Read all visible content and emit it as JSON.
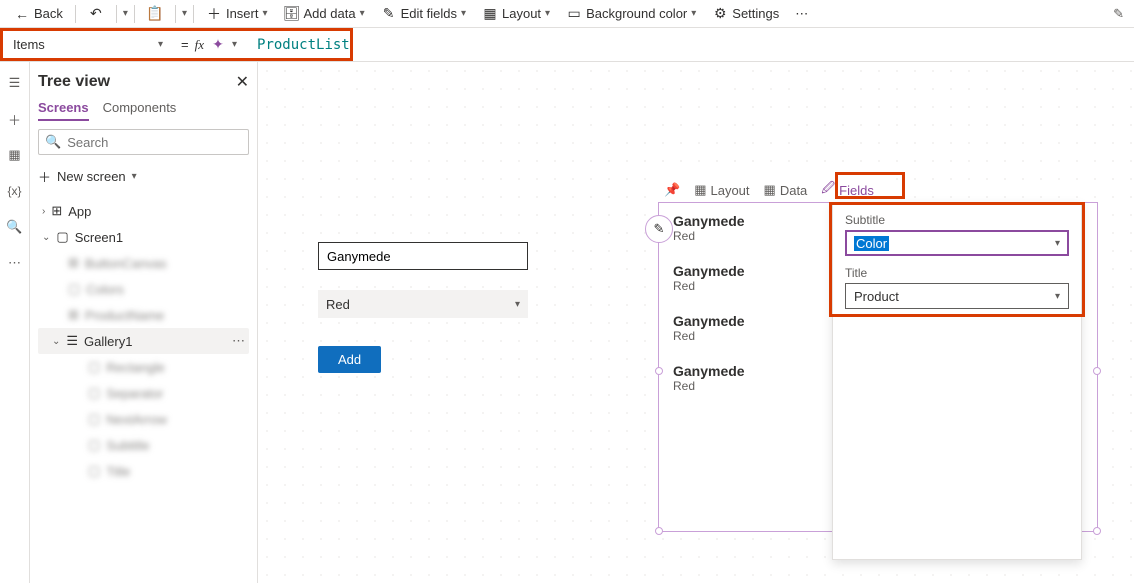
{
  "toolbar": {
    "back": "Back",
    "insert": "Insert",
    "add_data": "Add data",
    "edit_fields": "Edit fields",
    "layout": "Layout",
    "bgcolor": "Background color",
    "settings": "Settings"
  },
  "formula": {
    "property": "Items",
    "eq": "=",
    "fx": "fx",
    "value": "ProductList"
  },
  "tree": {
    "title": "Tree view",
    "tab_screens": "Screens",
    "tab_components": "Components",
    "search_ph": "Search",
    "new_screen": "New screen",
    "items": [
      "App",
      "Screen1",
      "ButtonCanvas",
      "Colors",
      "ProductName",
      "Gallery1",
      "Rectangle",
      "Separator",
      "NextArrow",
      "Subtitle",
      "Title"
    ]
  },
  "canvas": {
    "input_value": "Ganymede",
    "dd_value": "Red",
    "add_label": "Add"
  },
  "gallery_tabs": {
    "layout": "Layout",
    "data": "Data",
    "fields": "Fields"
  },
  "gallery": {
    "rows": [
      {
        "title": "Ganymede",
        "sub": "Red"
      },
      {
        "title": "Ganymede",
        "sub": "Red"
      },
      {
        "title": "Ganymede",
        "sub": "Red"
      },
      {
        "title": "Ganymede",
        "sub": "Red"
      }
    ]
  },
  "fields_popup": {
    "subtitle_lbl": "Subtitle",
    "subtitle_val": "Color",
    "title_lbl": "Title",
    "title_val": "Product"
  }
}
